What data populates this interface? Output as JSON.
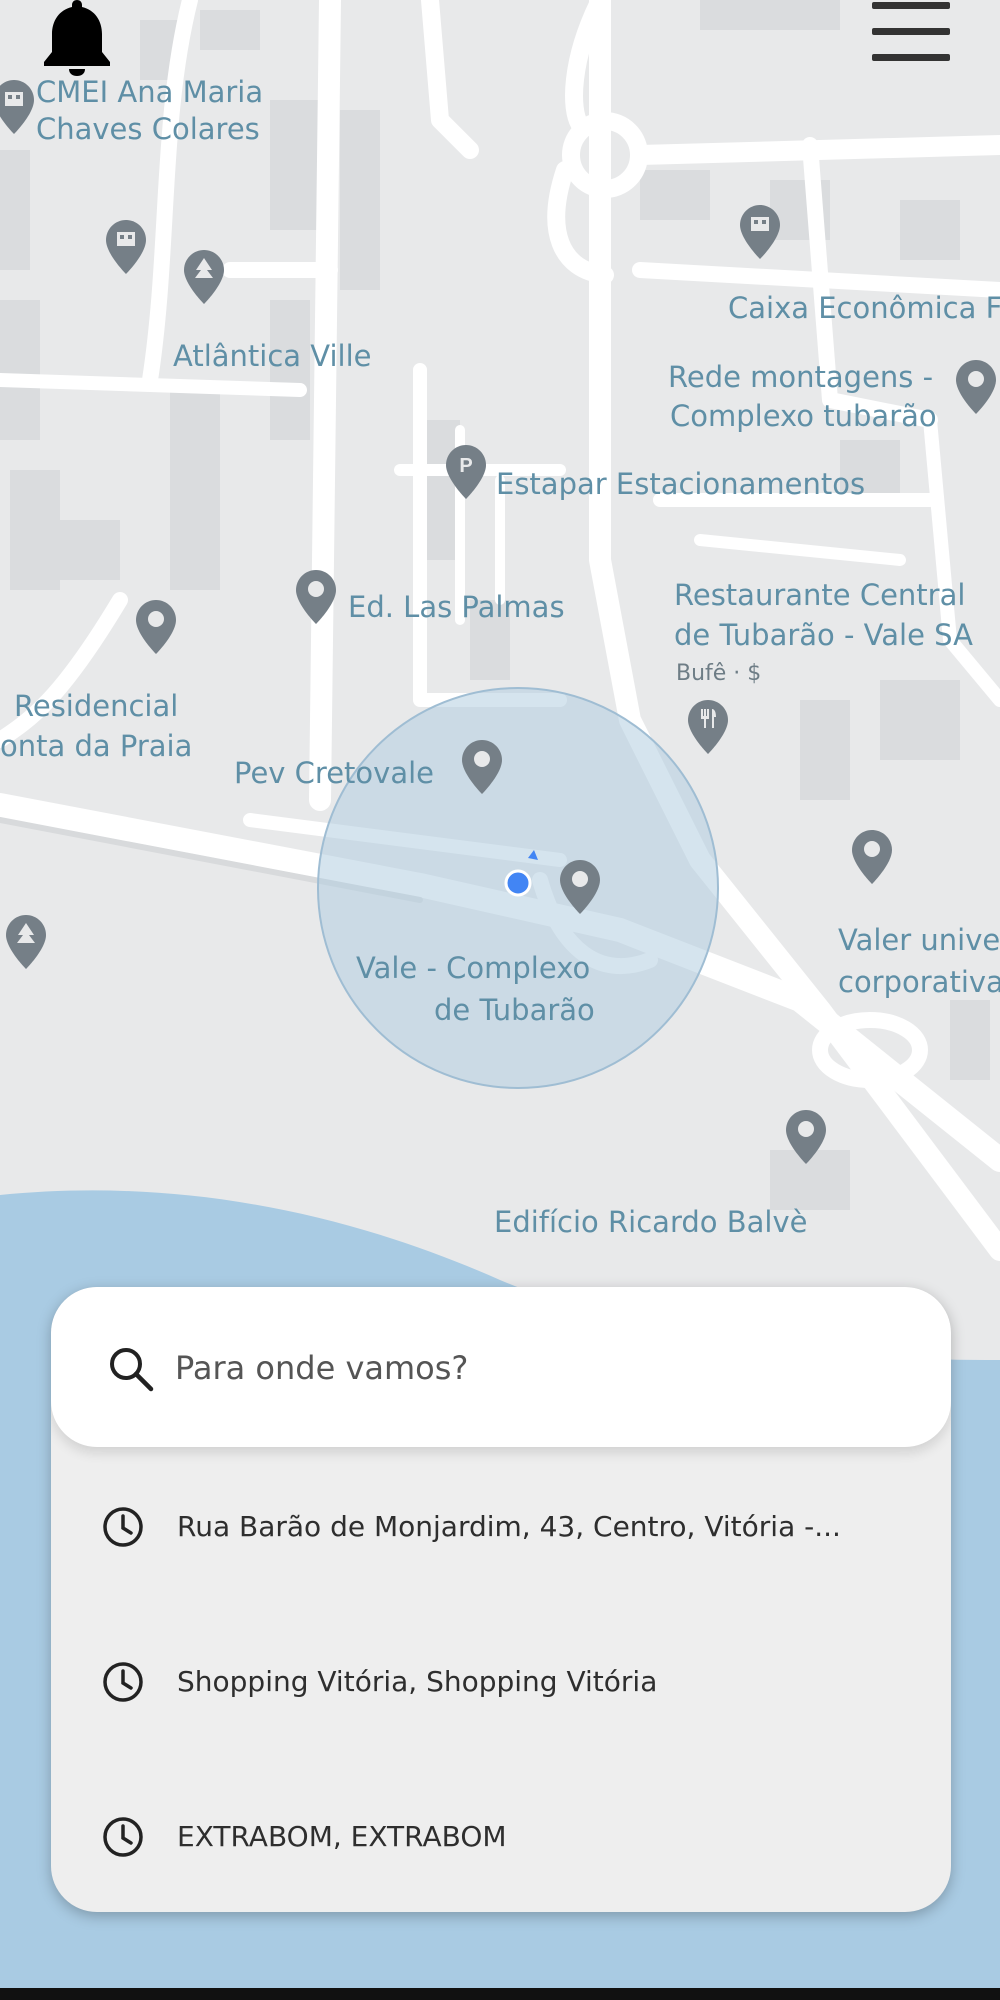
{
  "search": {
    "placeholder": "Para onde vamos?"
  },
  "recent_places": [
    {
      "label": "Rua Barão de Monjardim, 43, Centro, Vitória -..."
    },
    {
      "label": "Shopping Vitória, Shopping Vitória"
    },
    {
      "label": "EXTRABOM, EXTRABOM"
    }
  ],
  "map": {
    "labels": {
      "cmei_line1": "CMEI Ana Maria",
      "cmei_line2": "Chaves Colares",
      "atlantica": "Atlântica Ville",
      "caixa": "Caixa Econômica F",
      "rede_line1": "Rede montagens -",
      "rede_line2": "Complexo tubarão",
      "estapar": "Estapar Estacionamentos",
      "las_palmas": "Ed. Las Palmas",
      "restaurante_line1": "Restaurante Central",
      "restaurante_line2": "de Tubarão - Vale SA",
      "restaurante_sub": "Bufê · $",
      "residencial_line1": "Residencial",
      "residencial_line2": "onta da Praia",
      "pev": "Pev Cretovale",
      "vale_line1": "Vale - Complexo",
      "vale_line2": "de Tubarão",
      "valer_line1": "Valer unive",
      "valer_line2": "corporativa",
      "ricardo": "Edifício Ricardo Balvè"
    }
  },
  "icons": {
    "notifications": "bell-icon",
    "menu": "hamburger-menu-icon",
    "search": "search-icon",
    "recent": "clock-icon"
  },
  "colors": {
    "map_land": "#e8e9ea",
    "map_road": "#ffffff",
    "water": "#a9cbe3",
    "accuracy_circle": "#b3cde0",
    "location_dot": "#4285f4",
    "poi_text": "#5f8fa6",
    "pin": "#757f87"
  }
}
